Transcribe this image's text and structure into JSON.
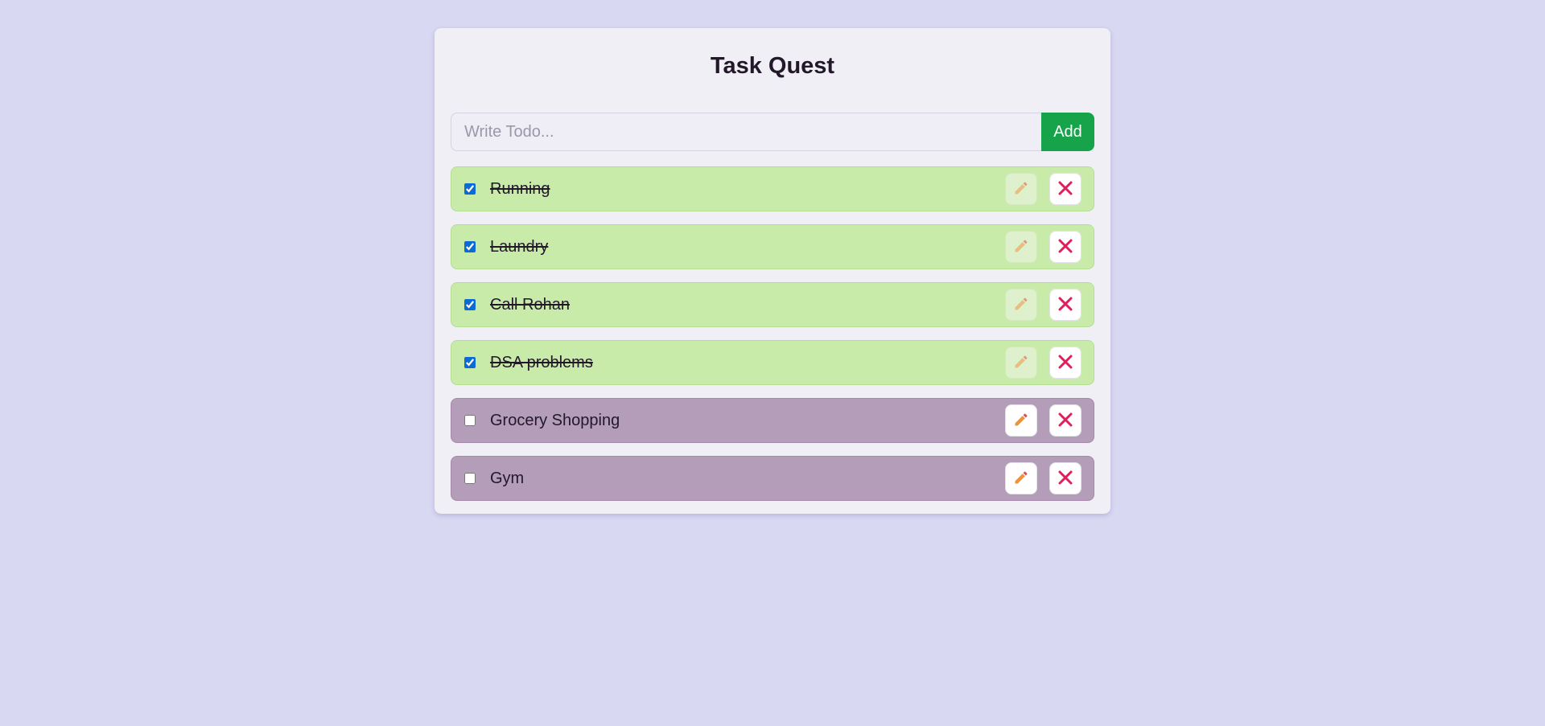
{
  "app": {
    "title": "Task Quest"
  },
  "add_form": {
    "placeholder": "Write Todo...",
    "value": "",
    "add_label": "Add"
  },
  "todos": [
    {
      "text": "Running",
      "completed": true
    },
    {
      "text": "Laundry",
      "completed": true
    },
    {
      "text": "Call Rohan",
      "completed": true
    },
    {
      "text": "DSA problems",
      "completed": true
    },
    {
      "text": "Grocery Shopping",
      "completed": false
    },
    {
      "text": "Gym",
      "completed": false
    }
  ],
  "icons": {
    "edit": "pencil-icon",
    "delete": "close-icon"
  },
  "colors": {
    "background": "#d9d8f3",
    "card": "#f0eff5",
    "accent_add": "#16a34a",
    "completed_row": "#c9ebaa",
    "pending_row": "#b39db8",
    "delete_icon": "#e11d5a",
    "edit_icon": "#f0923a"
  }
}
